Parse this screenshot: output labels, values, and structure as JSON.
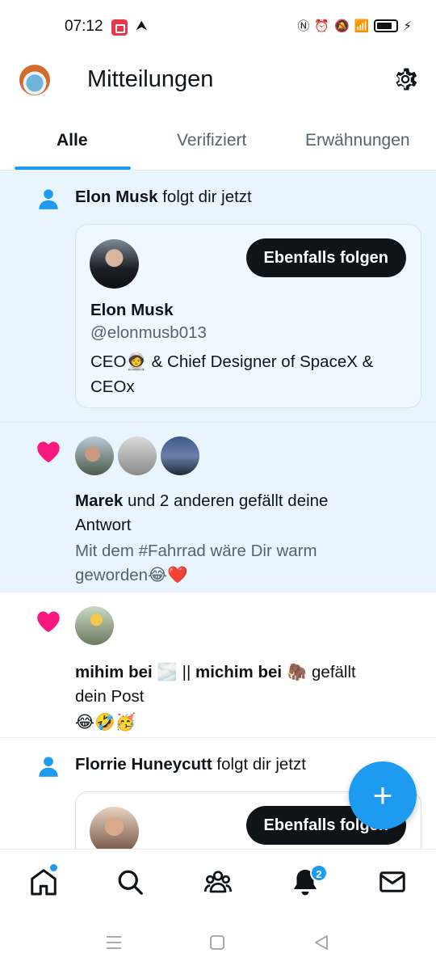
{
  "status_bar": {
    "time": "07:12"
  },
  "header": {
    "title": "Mitteilungen"
  },
  "tabs": [
    {
      "label": "Alle",
      "active": true
    },
    {
      "label": "Verifiziert",
      "active": false
    },
    {
      "label": "Erwähnungen",
      "active": false
    }
  ],
  "notifications": [
    {
      "type": "follow",
      "name": "Elon Musk",
      "action": "folgt dir jetzt",
      "card": {
        "button_label": "Ebenfalls folgen",
        "name": "Elon Musk",
        "handle": "@elonmusb013",
        "bio": "CEO🧑‍🚀 & Chief Designer of SpaceX & CEOx"
      }
    },
    {
      "type": "like",
      "name": "Marek",
      "action_line1": "und 2 anderen gefällt deine",
      "action_line2": "Antwort",
      "quote_line1": "Mit dem #Fahrrad wäre Dir warm",
      "quote_line2": "geworden😂❤️"
    },
    {
      "type": "like",
      "name1": "mihim bei",
      "emoji1": "🌫️",
      "separator": "||",
      "name2": "michim bei",
      "emoji2": "🦣",
      "action_tail": "gefällt",
      "action_line2": "dein Post",
      "quote": "😂🤣🥳"
    },
    {
      "type": "follow",
      "name": "Florrie Huneycutt",
      "action": "folgt dir jetzt",
      "card": {
        "button_label": "Ebenfalls folgen"
      }
    }
  ],
  "fab": {
    "label": "+"
  },
  "bottom_nav": {
    "notifications_badge": "2"
  },
  "colors": {
    "accent": "#1d9bf0",
    "heart": "#f91880",
    "unread_bg": "#e8f5fd",
    "text": "#0f1419",
    "muted": "#536471"
  }
}
